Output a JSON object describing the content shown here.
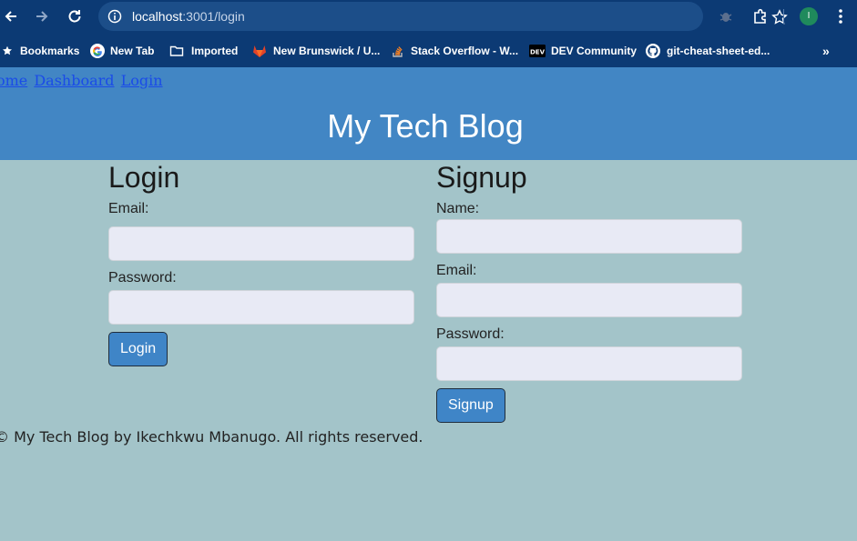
{
  "browser": {
    "url_host": "localhost",
    "url_path": ":3001/login",
    "avatar_initial": "I",
    "bookmarks": [
      {
        "label": "Bookmarks",
        "icon": "star-icon"
      },
      {
        "label": "New Tab",
        "icon": "google-icon"
      },
      {
        "label": "Imported",
        "icon": "folder-icon"
      },
      {
        "label": "New Brunswick / U...",
        "icon": "gitlab-icon"
      },
      {
        "label": "Stack Overflow - W...",
        "icon": "stackoverflow-icon"
      },
      {
        "label": "DEV Community",
        "icon": "dev-icon"
      },
      {
        "label": "git-cheat-sheet-ed...",
        "icon": "github-icon"
      }
    ],
    "more_label": "»"
  },
  "nav": {
    "home": "Home",
    "dashboard": "Dashboard",
    "login": "Login"
  },
  "site": {
    "title": "My Tech Blog"
  },
  "login": {
    "heading": "Login",
    "email_label": "Email:",
    "password_label": "Password:",
    "button": "Login"
  },
  "signup": {
    "heading": "Signup",
    "name_label": "Name:",
    "email_label": "Email:",
    "password_label": "Password:",
    "button": "Signup"
  },
  "footer": {
    "text": "© My Tech Blog by Ikechkwu Mbanugo. All rights reserved."
  },
  "colors": {
    "chrome": "#0c3a74",
    "header": "#4286c4",
    "page_bg": "#a3c4c9",
    "button": "#3f85c7"
  }
}
